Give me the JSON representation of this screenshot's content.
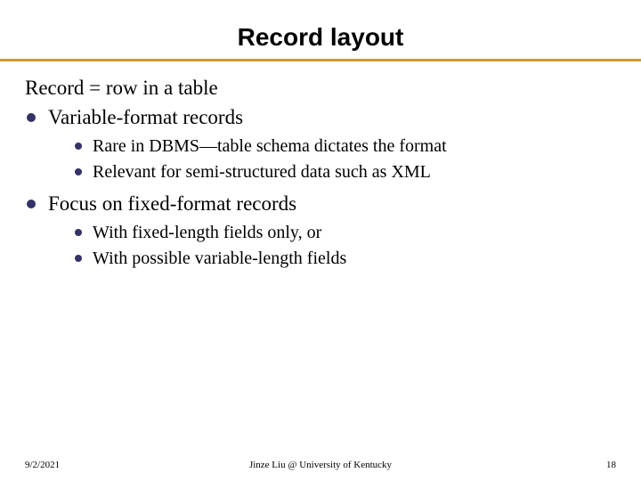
{
  "title": "Record layout",
  "intro": "Record = row in a table",
  "bullets": [
    {
      "text": "Variable-format records",
      "children": [
        "Rare in DBMS—table schema dictates the format",
        "Relevant for semi-structured data such as XML"
      ]
    },
    {
      "text": "Focus on fixed-format records",
      "children": [
        "With fixed-length fields only, or",
        "With possible variable-length fields"
      ]
    }
  ],
  "footer": {
    "date": "9/2/2021",
    "attribution": "Jinze Liu @ University of Kentucky",
    "page": "18"
  },
  "colors": {
    "rule": "#cc9933",
    "bullet": "#333366"
  }
}
